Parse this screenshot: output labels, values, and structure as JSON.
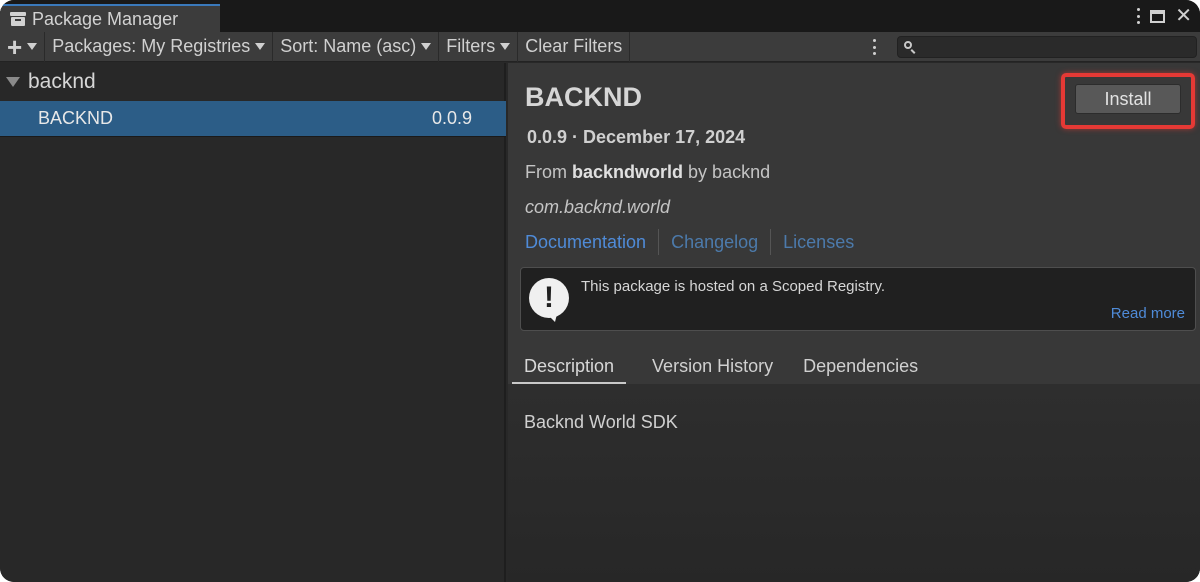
{
  "window": {
    "tab_title": "Package Manager"
  },
  "toolbar": {
    "packages_filter": "Packages: My Registries",
    "sort": "Sort: Name (asc)",
    "filters": "Filters",
    "clear_filters": "Clear Filters",
    "search_value": ""
  },
  "list": {
    "group_name": "backnd",
    "items": [
      {
        "name": "BACKND",
        "version": "0.0.9",
        "selected": true
      }
    ]
  },
  "details": {
    "title": "BACKND",
    "version_date": "0.0.9 · December 17, 2024",
    "from_prefix": "From",
    "registry": "backndworld",
    "by_author": "by backnd",
    "package_id": "com.backnd.world",
    "links": {
      "documentation": "Documentation",
      "changelog": "Changelog",
      "licenses": "Licenses"
    },
    "install_label": "Install",
    "notice": {
      "text": "This package is hosted on a Scoped Registry.",
      "read_more": "Read more"
    },
    "tabs": [
      {
        "label": "Description",
        "active": true
      },
      {
        "label": "Version History",
        "active": false
      },
      {
        "label": "Dependencies",
        "active": false
      }
    ],
    "description": "Backnd World SDK"
  },
  "colors": {
    "selection": "#2c5d87",
    "link": "#4f8bd8",
    "highlight": "#e53935"
  }
}
